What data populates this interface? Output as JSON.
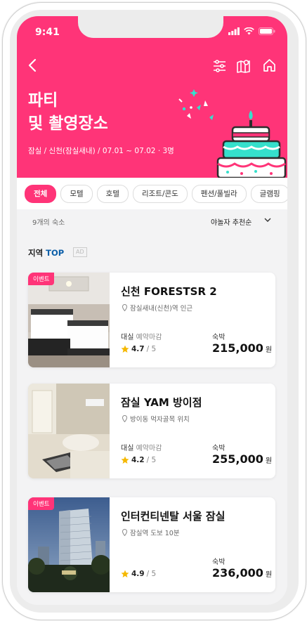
{
  "status_bar": {
    "time": "9:41"
  },
  "header": {
    "title": "파티\n및 촬영장소",
    "subtitle": "잠실 / 신천(잠실새내) / 07.01 ~ 07.02 · 3명"
  },
  "filters": [
    "전체",
    "모텔",
    "호텔",
    "리조트/콘도",
    "펜션/풀빌라",
    "글램핑"
  ],
  "list_meta": {
    "count": "9개의 숙소",
    "sort": "야놀자 추천순"
  },
  "section": {
    "title_prefix": "지역 ",
    "title_accent": "TOP",
    "ad": "AD"
  },
  "cards": [
    {
      "badge": "이벤트",
      "name": "신천 FORESTSR 2",
      "location": "잠실새내(신천)역 인근",
      "daesil_label": "대실",
      "daesil_status": "예약마감",
      "rating": "4.7",
      "rating_max": "/ 5",
      "stay_label": "숙박",
      "price": "215,000",
      "currency": "원"
    },
    {
      "badge": "",
      "name": "잠실 YAM 방이점",
      "location": "방이동 먹자골목 위치",
      "daesil_label": "대실",
      "daesil_status": "예약마감",
      "rating": "4.2",
      "rating_max": "/ 5",
      "stay_label": "숙박",
      "price": "255,000",
      "currency": "원"
    },
    {
      "badge": "이벤트",
      "name": "인터컨티넨탈 서울 잠실",
      "location": "잠실역 도보 10분",
      "daesil_label": "",
      "daesil_status": "",
      "rating": "4.9",
      "rating_max": "/ 5",
      "stay_label": "숙박",
      "price": "236,000",
      "currency": "원"
    }
  ],
  "colors": {
    "brand": "#ff3478",
    "accent_blue": "#0b5ea8",
    "star": "#f5b800"
  }
}
